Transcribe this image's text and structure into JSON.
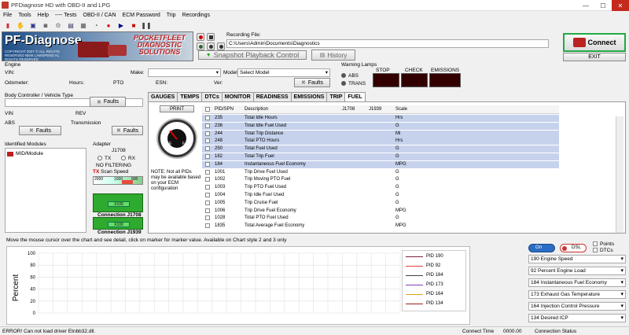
{
  "window": {
    "title": "PFDiagnose HD with OBD-II and LPG"
  },
  "menu": [
    "File",
    "Tools",
    "Help",
    "---- Tests",
    "OBD-II / CAN",
    "ECM Password",
    "Trip",
    "Recordings"
  ],
  "toolbar_icons": [
    "doc-icon",
    "hand-icon",
    "save-icon",
    "camera-icon",
    "gear-icon",
    "ecm-icon",
    "grid-icon",
    "dashboard-icon",
    "record-icon",
    "play-icon",
    "stop-icon",
    "pause-icon"
  ],
  "logo": {
    "brand": "PF-Diagnose",
    "tagline": "COPYRIGHT 2007 © ALL RIGHTS RESERVED NEW LAWSPEND AL RIGHTS RESERVED",
    "pocketfleet": "POCKETFLEET DIAGNOSTIC SOLUTIONS"
  },
  "recording": {
    "label": "Recording File:",
    "path": "C:\\Users\\Admin\\Documents\\Diagnostics",
    "snapshot": "Snapshot Playback Control",
    "history": "History"
  },
  "connect": {
    "label": "Connect",
    "exit": "EXIT"
  },
  "engine": {
    "section": "Engine",
    "vin": "VIN:",
    "make": "Make:",
    "model_label": "Model",
    "model_value": "Select Model",
    "odometer": "Odometer:",
    "hours": "Hours:",
    "pto": "PTO",
    "esn": "ESN:",
    "ver": "Ver:",
    "faults": "Faults"
  },
  "warning_lamps": {
    "title": "Warning Lamps",
    "abs": "ABS",
    "trans": "TRANS",
    "stop": "STOP",
    "check": "CHECK",
    "emissions": "EMISSIONS"
  },
  "left": {
    "body_controller": "Body Controller / Vehicle Type",
    "vin": "VIN",
    "rev": "REV",
    "abs": "ABS",
    "transmission": "Transmission",
    "faults": "Faults",
    "identified_modules": "Identified Modules",
    "module_item": "MID/Module",
    "adapter": "Adapter",
    "j1708": "J1708",
    "tx": "TX",
    "rx": "RX",
    "no_filtering": "NO FILTERING",
    "scan_speed": "Scan Speed",
    "scan_scale": [
      "2000",
      "1000",
      "500"
    ],
    "conn1_x": "X100",
    "conn1": "Connection J1708",
    "conn2_x": "X100",
    "conn2": "Connection J1939"
  },
  "tabs": [
    "GAUGES",
    "TEMPS",
    "DTCs",
    "MONITOR",
    "READINESS",
    "EMISSIONS",
    "TRIP",
    "FUEL"
  ],
  "active_tab": "FUEL",
  "fuel": {
    "print": "PRINT",
    "note": "NOTE: Not all PIDs may be available based on your ECM configuration",
    "headers": {
      "pid": "PID/SPN",
      "desc": "Description",
      "j1708": "J1708",
      "j1939": "J1939",
      "scale": "Scale"
    },
    "rows": [
      {
        "pid": "235",
        "desc": "Total Idle Hours",
        "scale": "Hrs"
      },
      {
        "pid": "236",
        "desc": "Total Idle Fuel Used",
        "scale": "G"
      },
      {
        "pid": "244",
        "desc": "Total Trip Distance",
        "scale": "Mi"
      },
      {
        "pid": "248",
        "desc": "Total PTO Hours",
        "scale": "Hrs"
      },
      {
        "pid": "250",
        "desc": "Total Fuel Used",
        "scale": "G"
      },
      {
        "pid": "182",
        "desc": "Total Trip Fuel",
        "scale": "G"
      },
      {
        "pid": "184",
        "desc": "Instantaneous Fuel Economy",
        "scale": "MPG"
      },
      {
        "pid": "1001",
        "desc": "Trip Drive Fuel Used",
        "scale": "G"
      },
      {
        "pid": "1002",
        "desc": "Trip Moving PTO Fuel",
        "scale": "G"
      },
      {
        "pid": "1003",
        "desc": "Trip PTO Fuel Used",
        "scale": "G"
      },
      {
        "pid": "1004",
        "desc": "Trip Idle Fuel Used",
        "scale": "G"
      },
      {
        "pid": "1005",
        "desc": "Trip Cruise Fuel",
        "scale": "G"
      },
      {
        "pid": "1006",
        "desc": "Trip Drive Fuel Economy",
        "scale": "MPG"
      },
      {
        "pid": "1028",
        "desc": "Total PTO Fuel Used",
        "scale": "G"
      },
      {
        "pid": "1835",
        "desc": "Total Average Fuel Economy",
        "scale": "MPG"
      }
    ]
  },
  "chart": {
    "hint": "Move the mouse cursor over the chart and see detail, click on marker for marker value. Available on Chart style 2 and 3 only",
    "ylabel": "Percent",
    "yticks": [
      "100",
      "80",
      "60",
      "40",
      "20",
      "0"
    ],
    "legend": [
      {
        "name": "PID 190",
        "color": "#7a1f4a"
      },
      {
        "name": "PID 92",
        "color": "#e04040"
      },
      {
        "name": "PID 184",
        "color": "#404040"
      },
      {
        "name": "PID 173",
        "color": "#8040c0"
      },
      {
        "name": "PID 164",
        "color": "#e0a020"
      },
      {
        "name": "PID 134",
        "color": "#a02020"
      }
    ]
  },
  "chart_controls": {
    "on": "On",
    "dsl": "DSL",
    "points": "Points",
    "dtcs": "DTCs",
    "selects": [
      "190 Engine Speed",
      "92 Percent Engine Load",
      "184 Instantaneous Fuel Economy",
      "173 Exhaust Gas Temperature",
      "164 Injection Control Pressure",
      "134 Desired ICP"
    ]
  },
  "status": {
    "error": "ERROR! Can not load driver Etnbb32.dll.",
    "connect_time_label": "Connect Time",
    "connect_time": "0000.00",
    "connection_status": "Connection Status"
  },
  "colors": {
    "selected_row": "#c6d2ec",
    "accent": "#1d4e86",
    "green": "#2eaa2e"
  }
}
